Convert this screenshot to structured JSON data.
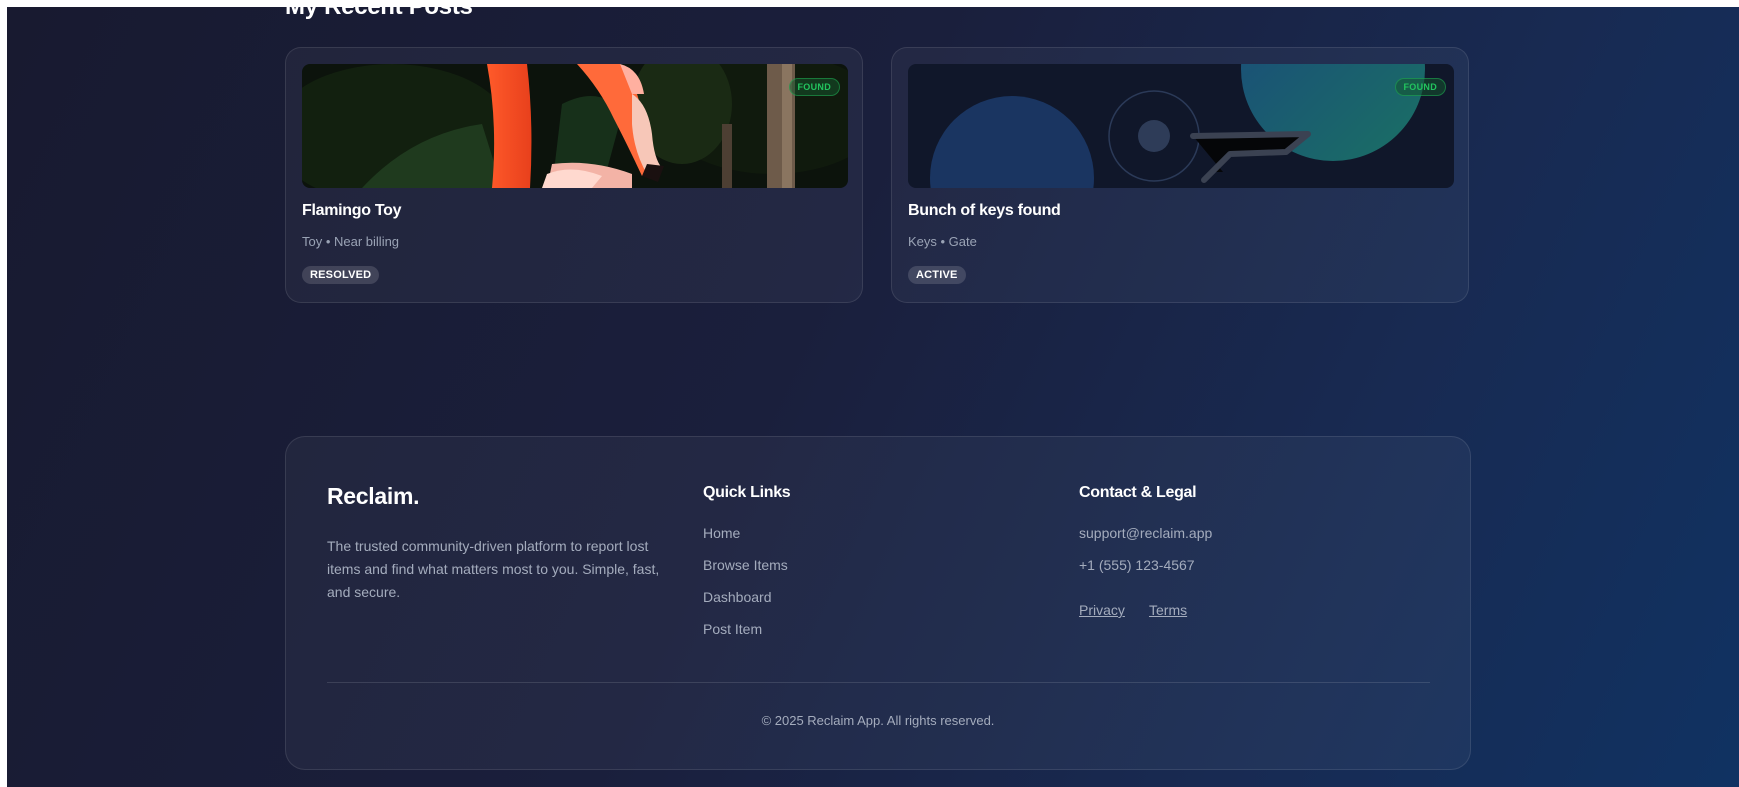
{
  "section": {
    "title": "My Recent Posts"
  },
  "posts": [
    {
      "title": "Flamingo Toy",
      "meta": "Toy • Near billing",
      "status": "RESOLVED",
      "badge": "FOUND"
    },
    {
      "title": "Bunch of keys found",
      "meta": "Keys • Gate",
      "status": "ACTIVE",
      "badge": "FOUND"
    }
  ],
  "footer": {
    "brand": "Reclaim.",
    "tagline": "The trusted community-driven platform to report lost items and find what matters most to you. Simple, fast, and secure.",
    "quick_links_heading": "Quick Links",
    "quick_links": [
      "Home",
      "Browse Items",
      "Dashboard",
      "Post Item"
    ],
    "contact_heading": "Contact & Legal",
    "email": "support@reclaim.app",
    "phone": "+1 (555) 123-4567",
    "privacy": "Privacy",
    "terms": "Terms",
    "copyright": "© 2025 Reclaim App. All rights reserved."
  },
  "colors": {
    "found": "#22c55e",
    "background_start": "#181a30",
    "background_end": "#103262"
  },
  "icons": {
    "post1_image": "flamingo-photo",
    "post2_image": "keys-illustration"
  }
}
